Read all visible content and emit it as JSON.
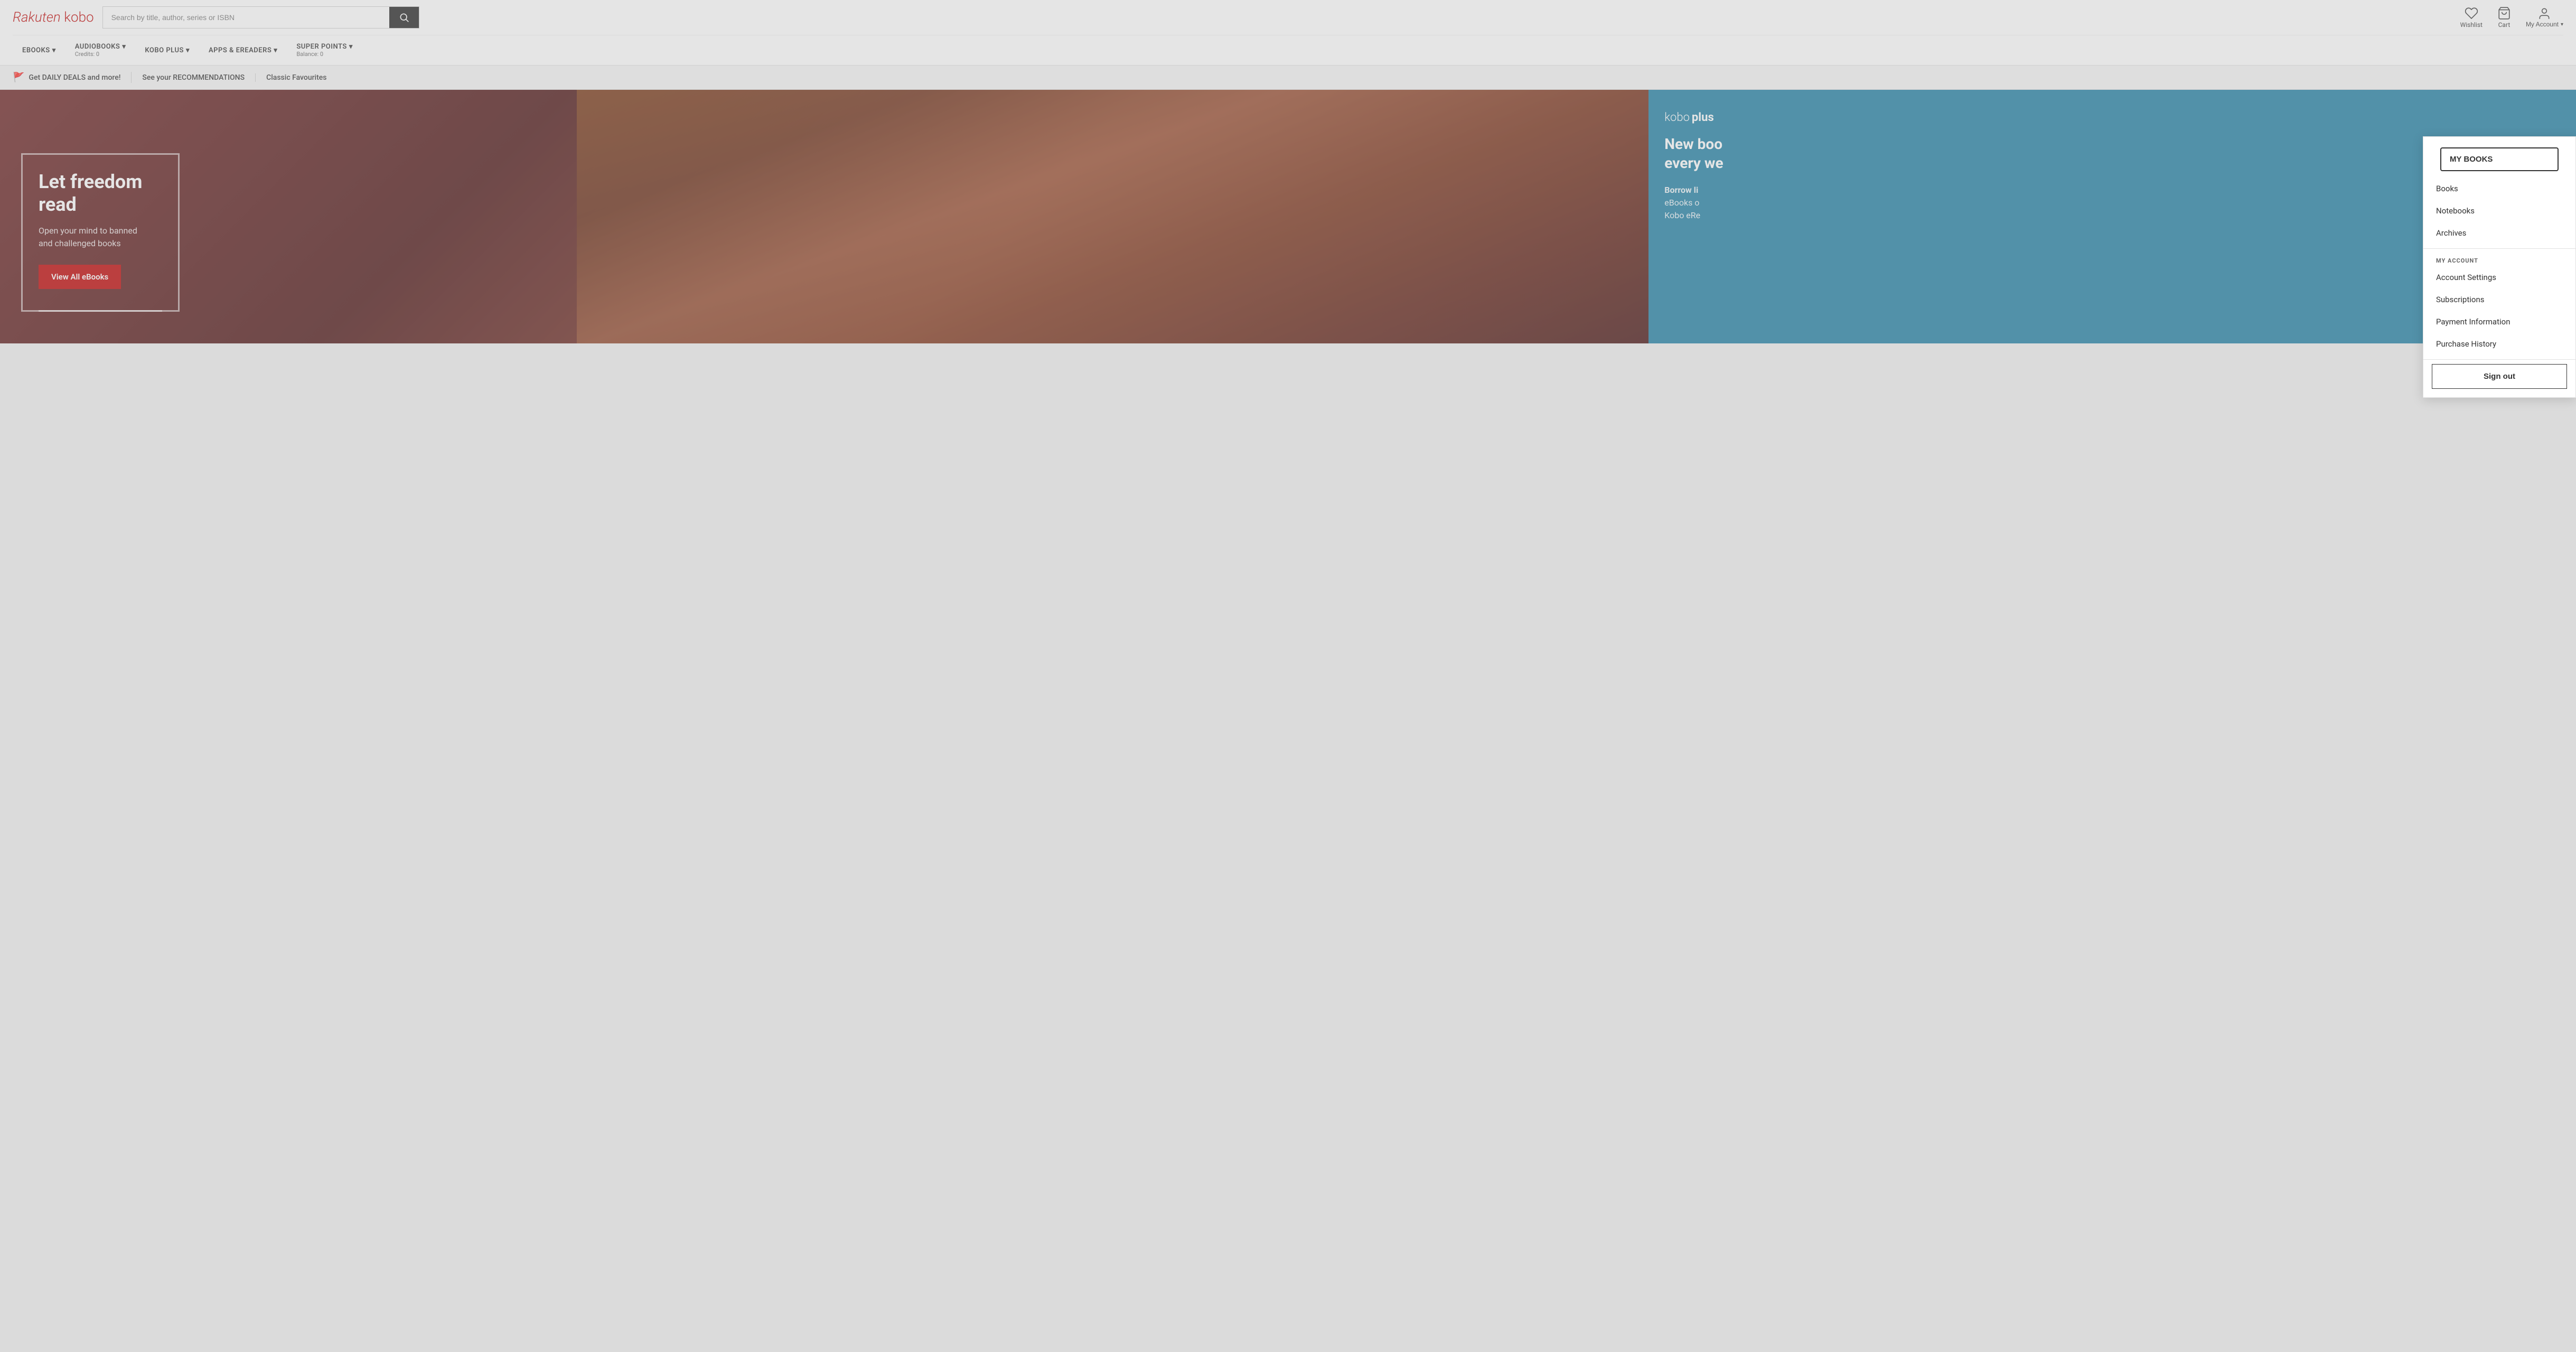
{
  "logo": {
    "brand": "Rakuten",
    "product": "kobo"
  },
  "search": {
    "placeholder": "Search by title, author, series or ISBN"
  },
  "header_icons": {
    "wishlist_label": "Wishlist",
    "cart_label": "Cart",
    "account_label": "My Account",
    "account_chevron": "▾"
  },
  "nav": {
    "items": [
      {
        "label": "eBOOKS",
        "sub": null
      },
      {
        "label": "AUDIOBOOKS",
        "sub": "Credits: 0"
      },
      {
        "label": "KOBO PLUS",
        "sub": null
      },
      {
        "label": "APPS & eREADERS",
        "sub": null
      },
      {
        "label": "SUPER POINTS",
        "sub": "Balance: 0"
      }
    ]
  },
  "promo_bar": {
    "items": [
      {
        "icon": "flag",
        "text": "Get DAILY DEALS and more!"
      },
      {
        "icon": null,
        "text": "See your RECOMMENDATIONS"
      },
      {
        "icon": null,
        "text": "Classic Favourites"
      }
    ]
  },
  "hero": {
    "title": "Let freedom read",
    "subtitle": "Open your mind to banned\nand challenged books",
    "cta_label": "View All eBooks"
  },
  "side_panel": {
    "brand_word1": "kobo",
    "brand_word2": "plus",
    "headline1": "New boo",
    "headline2": "every we",
    "subtext1": "Borrow li",
    "subtext2": "eBooks o",
    "subtext3": "Kobo eRe"
  },
  "dropdown": {
    "my_books_section_label": "MY BOOKS",
    "my_books_active": "MY BOOKS",
    "books_label": "Books",
    "notebooks_label": "Notebooks",
    "archives_label": "Archives",
    "my_account_section_label": "MY ACCOUNT",
    "account_settings_label": "Account Settings",
    "subscriptions_label": "Subscriptions",
    "payment_info_label": "Payment Information",
    "purchase_history_label": "Purchase History",
    "sign_out_label": "Sign out"
  }
}
